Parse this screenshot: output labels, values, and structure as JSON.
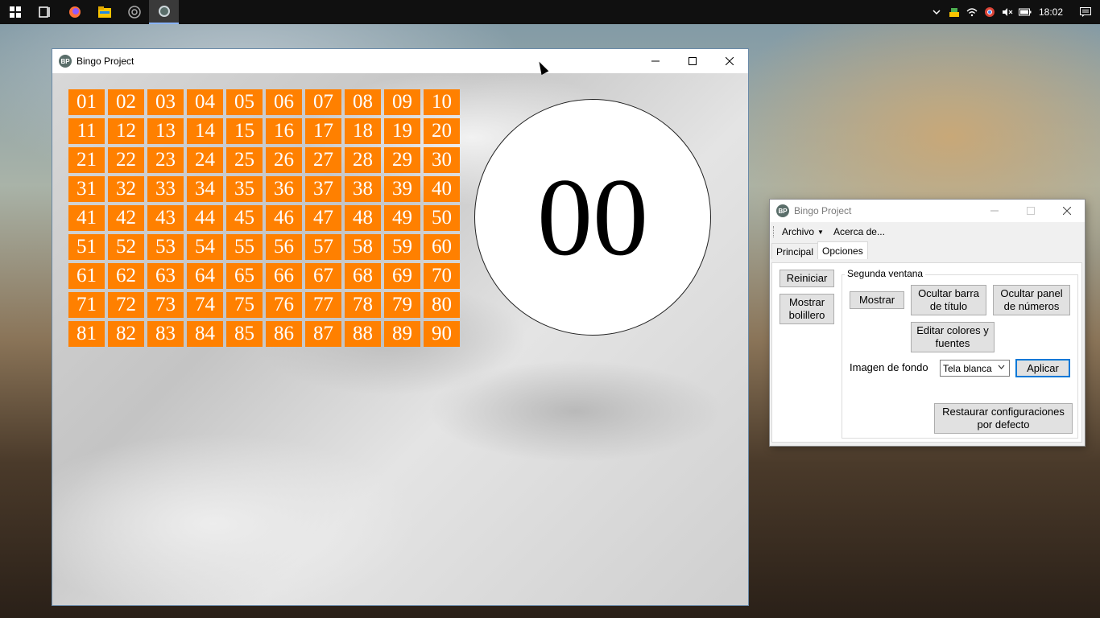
{
  "taskbar": {
    "clock": "18:02",
    "pinned_icons": [
      "windows-start-icon",
      "task-view-icon",
      "firefox-icon",
      "file-explorer-icon",
      "chrome-icon",
      "bingo-project-icon"
    ]
  },
  "main_window": {
    "title": "Bingo Project",
    "icon_text": "BP",
    "numbers": [
      "01",
      "02",
      "03",
      "04",
      "05",
      "06",
      "07",
      "08",
      "09",
      "10",
      "11",
      "12",
      "13",
      "14",
      "15",
      "16",
      "17",
      "18",
      "19",
      "20",
      "21",
      "22",
      "23",
      "24",
      "25",
      "26",
      "27",
      "28",
      "29",
      "30",
      "31",
      "32",
      "33",
      "34",
      "35",
      "36",
      "37",
      "38",
      "39",
      "40",
      "41",
      "42",
      "43",
      "44",
      "45",
      "46",
      "47",
      "48",
      "49",
      "50",
      "51",
      "52",
      "53",
      "54",
      "55",
      "56",
      "57",
      "58",
      "59",
      "60",
      "61",
      "62",
      "63",
      "64",
      "65",
      "66",
      "67",
      "68",
      "69",
      "70",
      "71",
      "72",
      "73",
      "74",
      "75",
      "76",
      "77",
      "78",
      "79",
      "80",
      "81",
      "82",
      "83",
      "84",
      "85",
      "86",
      "87",
      "88",
      "89",
      "90"
    ],
    "current_number": "00",
    "number_bg_color": "#ff8000",
    "number_text_color": "#ffffff"
  },
  "options_window": {
    "title": "Bingo Project",
    "icon_text": "BP",
    "menu": {
      "archivo": "Archivo",
      "acerca": "Acerca de..."
    },
    "tabs": {
      "principal": "Principal",
      "opciones": "Opciones"
    },
    "buttons": {
      "reiniciar": "Reiniciar",
      "mostrar_bolillero": "Mostrar bolillero",
      "mostrar": "Mostrar",
      "ocultar_barra": "Ocultar barra de título",
      "ocultar_panel": "Ocultar panel de números",
      "editar_colores": "Editar colores y fuentes",
      "aplicar": "Aplicar",
      "restaurar": "Restaurar configuraciones por defecto"
    },
    "group_label": "Segunda ventana",
    "background_label": "Imagen de fondo",
    "background_select_value": "Tela blanca"
  }
}
